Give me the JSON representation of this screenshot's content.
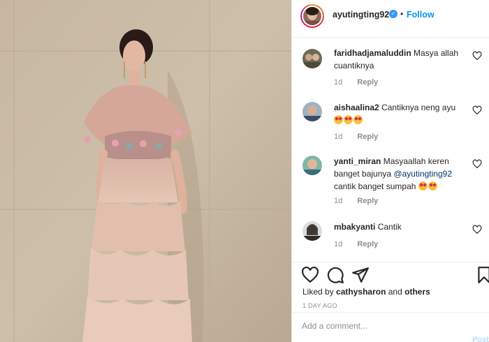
{
  "post": {
    "username": "ayutingting92",
    "dot": "•",
    "follow_label": "Follow"
  },
  "comments": [
    {
      "user": "faridhadjamaluddin",
      "text": "Masya allah cuantiknya",
      "mention": "",
      "after": "",
      "age": "1d",
      "reply": "Reply"
    },
    {
      "user": "aishaalina2",
      "text": "Cantiknya neng ayu",
      "mention": "",
      "after": "",
      "age": "1d",
      "reply": "Reply"
    },
    {
      "user": "yanti_miran",
      "text": "Masyaallah keren banget bajunya",
      "mention": "@ayutingting92",
      "after": "cantik banget sumpah",
      "age": "1d",
      "reply": "Reply"
    },
    {
      "user": "mbakyanti",
      "text": "Cantik",
      "mention": "",
      "after": "",
      "age": "1d",
      "reply": "Reply"
    }
  ],
  "actions": {
    "liked_prefix": "Liked by",
    "liked_user": "cathysharon",
    "liked_and": "and",
    "liked_others": "others",
    "timestamp": "1 DAY AGO",
    "comment_placeholder": "Add a comment...",
    "post_label": "Post"
  },
  "colors": {
    "link": "#0095f6",
    "verified": "#3897f0",
    "muted": "#8e8e8e"
  },
  "icons": [
    "heart-icon",
    "comment-icon",
    "share-icon",
    "bookmark-icon",
    "verified-icon"
  ]
}
